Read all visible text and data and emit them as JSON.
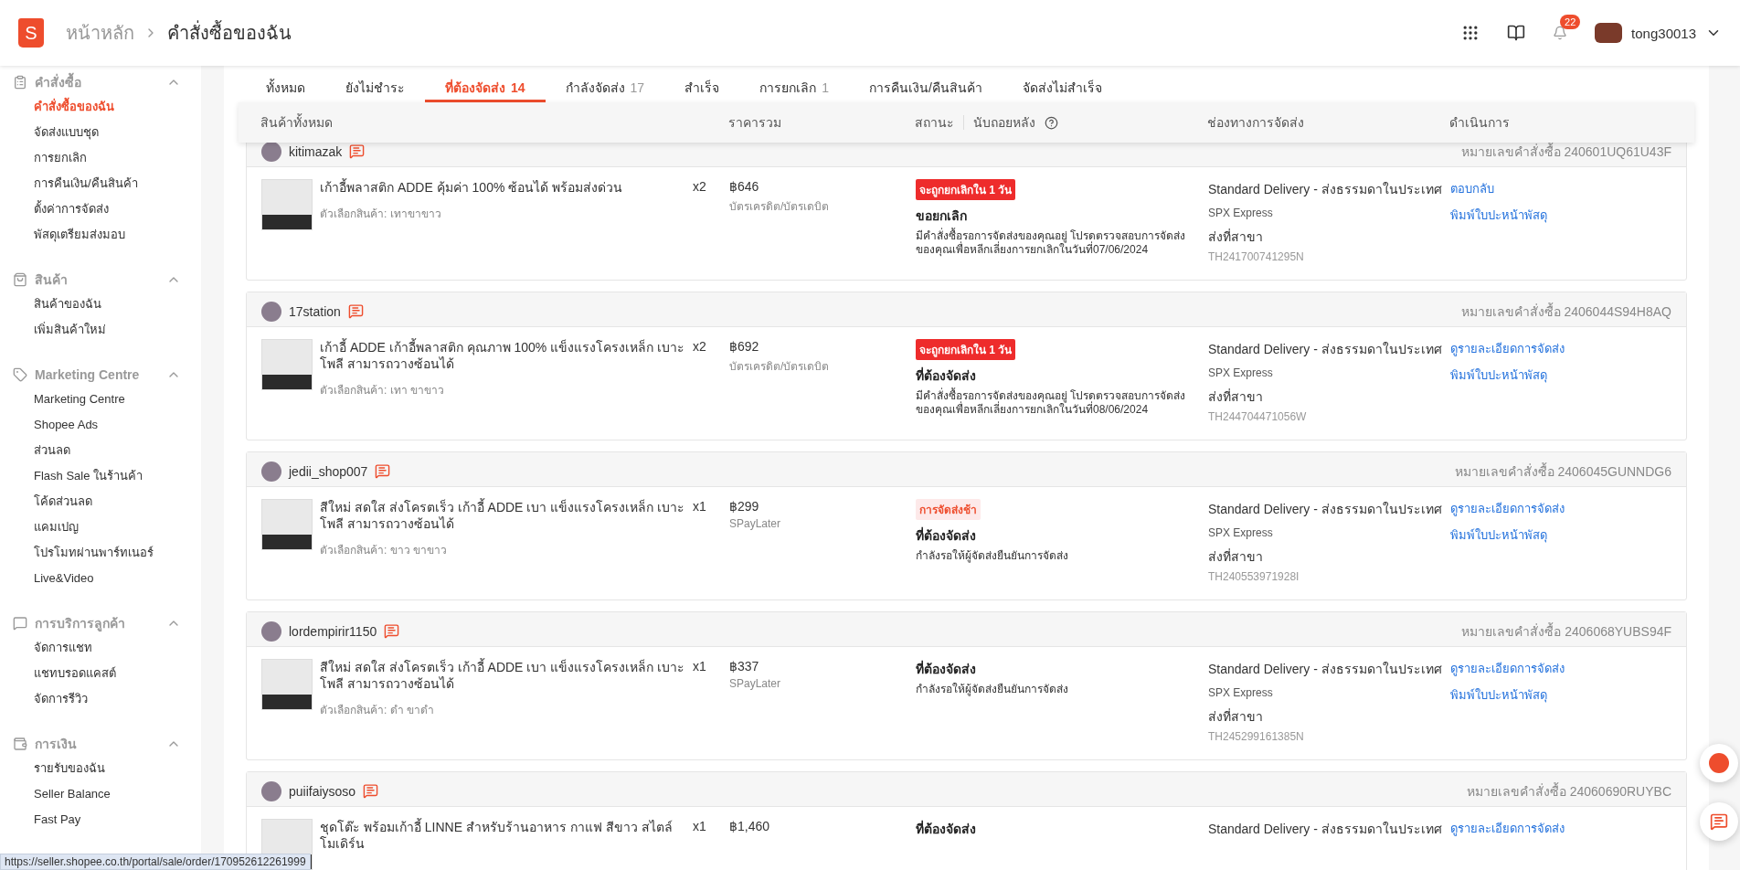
{
  "header": {
    "logo_letter": "S",
    "breadcrumb": [
      "หน้าหลัก",
      "คำสั่งซื้อของฉัน"
    ],
    "notification_count": "22",
    "username": "tong30013"
  },
  "sidebar": {
    "sections": [
      {
        "kind": "orders",
        "title": "คำสั่งซื้อ",
        "expanded": true,
        "items": [
          {
            "label": "คำสั่งซื้อของฉัน",
            "selected": true
          },
          {
            "label": "จัดส่งแบบชุด",
            "selected": false
          },
          {
            "label": "การยกเลิก",
            "selected": false
          },
          {
            "label": "การคืนเงิน/คืนสินค้า",
            "selected": false
          },
          {
            "label": "ตั้งค่าการจัดส่ง",
            "selected": false
          },
          {
            "label": "พัสดุเตรียมส่งมอบ",
            "selected": false
          }
        ]
      },
      {
        "kind": "products",
        "title": "สินค้า",
        "expanded": true,
        "items": [
          {
            "label": "สินค้าของฉัน",
            "selected": false
          },
          {
            "label": "เพิ่มสินค้าใหม่",
            "selected": false
          }
        ]
      },
      {
        "kind": "marketing",
        "title": "Marketing Centre",
        "expanded": true,
        "items": [
          {
            "label": "Marketing Centre",
            "selected": false
          },
          {
            "label": "Shopee Ads",
            "selected": false
          },
          {
            "label": "ส่วนลด",
            "selected": false
          },
          {
            "label": "Flash Sale ในร้านค้า",
            "selected": false
          },
          {
            "label": "โค้ดส่วนลด",
            "selected": false
          },
          {
            "label": "แคมเปญ",
            "selected": false
          },
          {
            "label": "โปรโมทผ่านพาร์ทเนอร์",
            "selected": false
          },
          {
            "label": "Live&Video",
            "selected": false
          }
        ]
      },
      {
        "kind": "service",
        "title": "การบริการลูกค้า",
        "expanded": true,
        "items": [
          {
            "label": "จัดการแชท",
            "selected": false
          },
          {
            "label": "แชทบรอดแคสต์",
            "selected": false
          },
          {
            "label": "จัดการรีวิว",
            "selected": false
          }
        ]
      },
      {
        "kind": "finance",
        "title": "การเงิน",
        "expanded": true,
        "items": [
          {
            "label": "รายรับของฉัน",
            "selected": false
          },
          {
            "label": "Seller Balance",
            "selected": false
          },
          {
            "label": "Fast Pay",
            "selected": false
          }
        ]
      }
    ]
  },
  "tabs": [
    {
      "label": "ทั้งหมด",
      "selected": false
    },
    {
      "label": "ยังไม่ชำระ",
      "selected": false
    },
    {
      "label": "ที่ต้องจัดส่ง",
      "count": "14",
      "selected": true
    },
    {
      "label": "กำลังจัดส่ง",
      "count": "17",
      "selected": false
    },
    {
      "label": "สำเร็จ",
      "selected": false
    },
    {
      "label": "การยกเลิก",
      "count": "1",
      "selected": false
    },
    {
      "label": "การคืนเงิน/คืนสินค้า",
      "selected": false
    },
    {
      "label": "จัดส่งไม่สำเร็จ",
      "selected": false
    }
  ],
  "table": {
    "columns": [
      "สินค้าทั้งหมด",
      "ราคารวม",
      "สถานะ",
      "นับถอยหลัง",
      "ช่องทางการจัดส่ง",
      "ดำเนินการ"
    ],
    "orders": [
      {
        "buyer": "kitimazak",
        "order_no": "หมายเลขคำสั่งซื้อ 240601UQ61U43F",
        "items": [
          {
            "name": "เก้าอี้พลาสติก ADDE คุ้มค่า 100% ซ้อนได้ พร้อมส่งด่วน",
            "variant": "ตัวเลือกสินค้า: เทาขาขาว",
            "qty": "x2"
          }
        ],
        "price": "฿646",
        "payment": "บัตรเครดิต/บัตรเดบิต",
        "badge": {
          "kind": "urgent",
          "text": "จะถูกยกเลิกใน 1 วัน"
        },
        "status": "ขอยกเลิก",
        "status_note": "มีคำสั่งซื้อรอการจัดส่งของคุณอยู่ โปรดตรวจสอบการจัดส่งของคุณเพื่อหลีกเลี่ยงการยกเลิกในวันที่07/06/2024",
        "shipping": {
          "method": "Standard Delivery - ส่งธรรมดาในประเทศ",
          "carrier": "SPX Express",
          "type": "ส่งที่สาขา",
          "tracking": "TH241700741295N"
        },
        "actions": [
          "ตอบกลับ",
          "พิมพ์ใบปะหน้าพัสดุ"
        ]
      },
      {
        "buyer": "17station",
        "order_no": "หมายเลขคำสั่งซื้อ 2406044S94H8AQ",
        "items": [
          {
            "name": "เก้าอี้ ADDE เก้าอี้พลาสติก คุณภาพ 100% แข็งแรงโครงเหล็ก เบาะโพลี สามารถวางซ้อนได้",
            "variant": "ตัวเลือกสินค้า: เทา ขาขาว",
            "qty": "x2"
          }
        ],
        "price": "฿692",
        "payment": "บัตรเครดิต/บัตรเดบิต",
        "badge": {
          "kind": "urgent",
          "text": "จะถูกยกเลิกใน 1 วัน"
        },
        "status": "ที่ต้องจัดส่ง",
        "status_note": "มีคำสั่งซื้อรอการจัดส่งของคุณอยู่ โปรดตรวจสอบการจัดส่งของคุณเพื่อหลีกเลี่ยงการยกเลิกในวันที่08/06/2024",
        "shipping": {
          "method": "Standard Delivery - ส่งธรรมดาในประเทศ",
          "carrier": "SPX Express",
          "type": "ส่งที่สาขา",
          "tracking": "TH244704471056W"
        },
        "actions": [
          "ดูรายละเอียดการจัดส่ง",
          "พิมพ์ใบปะหน้าพัสดุ"
        ]
      },
      {
        "buyer": "jedii_shop007",
        "order_no": "หมายเลขคำสั่งซื้อ 2406045GUNNDG6",
        "items": [
          {
            "name": "สีใหม่ สดใส ส่งโครตเร็ว เก้าอี้ ADDE เบา แข็งแรงโครงเหล็ก เบาะโพลี สามารถวางซ้อนได้",
            "variant": "ตัวเลือกสินค้า: ขาว ขาขาว",
            "qty": "x1"
          }
        ],
        "price": "฿299",
        "payment": "SPayLater",
        "badge": {
          "kind": "late",
          "text": "การจัดส่งช้า"
        },
        "status": "ที่ต้องจัดส่ง",
        "status_note": "กำลังรอให้ผู้จัดส่งยืนยันการจัดส่ง",
        "shipping": {
          "method": "Standard Delivery - ส่งธรรมดาในประเทศ",
          "carrier": "SPX Express",
          "type": "ส่งที่สาขา",
          "tracking": "TH240553971928I"
        },
        "actions": [
          "ดูรายละเอียดการจัดส่ง",
          "พิมพ์ใบปะหน้าพัสดุ"
        ]
      },
      {
        "buyer": "lordempirir1150",
        "order_no": "หมายเลขคำสั่งซื้อ 2406068YUBS94F",
        "items": [
          {
            "name": "สีใหม่ สดใส ส่งโครตเร็ว เก้าอี้ ADDE เบา แข็งแรงโครงเหล็ก เบาะโพลี สามารถวางซ้อนได้",
            "variant": "ตัวเลือกสินค้า: ดำ ขาดำ",
            "qty": "x1"
          }
        ],
        "price": "฿337",
        "payment": "SPayLater",
        "status": "ที่ต้องจัดส่ง",
        "status_note": "กำลังรอให้ผู้จัดส่งยืนยันการจัดส่ง",
        "shipping": {
          "method": "Standard Delivery - ส่งธรรมดาในประเทศ",
          "carrier": "SPX Express",
          "type": "ส่งที่สาขา",
          "tracking": "TH245299161385N"
        },
        "actions": [
          "ดูรายละเอียดการจัดส่ง",
          "พิมพ์ใบปะหน้าพัสดุ"
        ]
      },
      {
        "buyer": "puiifaiysoso",
        "order_no": "หมายเลขคำสั่งซื้อ 24060690RUYBC",
        "items": [
          {
            "name": "ชุดโต๊ะ พร้อมเก้าอี้ LINNE สำหรับร้านอาหาร กาแฟ สีขาว สไตล์โมเดิร์น",
            "qty": "x1"
          }
        ],
        "price": "฿1,460",
        "status": "ที่ต้องจัดส่ง",
        "shipping": {
          "method": "Standard Delivery - ส่งธรรมดาในประเทศ"
        },
        "actions": [
          "ดูรายละเอียดการจัดส่ง"
        ]
      }
    ]
  },
  "status_bar": "https://seller.shopee.co.th/portal/sale/order/170952612261999"
}
